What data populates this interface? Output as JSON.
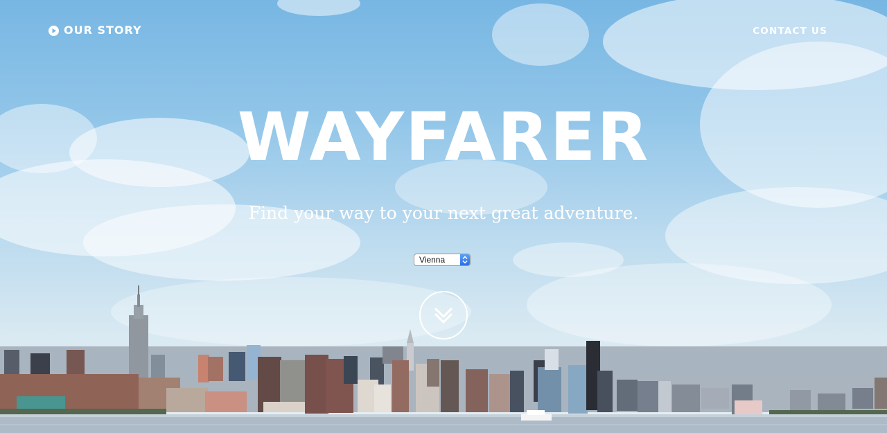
{
  "nav": {
    "left_label": "OUR STORY",
    "left_icon": "play-circle-icon",
    "right_label": "CONTACT US"
  },
  "hero": {
    "title": "WAYFARER",
    "subtitle": "Find your way to your next great adventure.",
    "city_select": {
      "selected": "Vienna"
    },
    "scroll_icon": "double-chevron-down-icon"
  },
  "colors": {
    "sky_top": "#6fb2e2",
    "sky_bottom": "#e6eef3",
    "text": "#ffffff",
    "select_arrow": "#2a6fe7"
  }
}
